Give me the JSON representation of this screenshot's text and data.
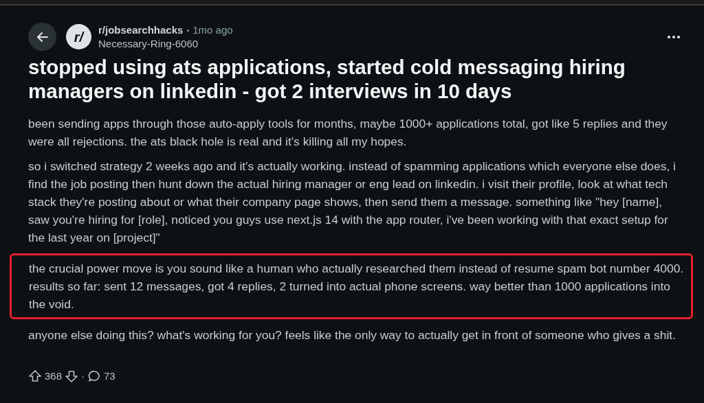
{
  "post": {
    "subreddit": "r/jobsearchhacks",
    "subreddit_icon": "r/",
    "separator": "•",
    "time": "1mo ago",
    "author": "Necessary-Ring-6060",
    "title": "stopped using ats applications, started cold messaging hiring managers on linkedin - got 2 interviews in 10 days",
    "paragraphs": [
      {
        "text": "been sending apps through those auto-apply tools for months, maybe 1000+ applications total, got like 5 replies and they were all rejections. the ats black hole is real and it's killing all my hopes.",
        "highlighted": false
      },
      {
        "text": "so i switched strategy 2 weeks ago and it's actually working. instead of spamming applications which everyone else does, i find the job posting then hunt down the actual hiring manager or eng lead on linkedin. i visit their profile, look at what tech stack they're posting about or what their company page shows, then send them a message. something like \"hey [name], saw you're hiring for [role], noticed you guys use next.js 14 with the app router, i've been working with that exact setup for the last year on [project]\"",
        "highlighted": false
      },
      {
        "text": "the crucial power move is you sound like a human who actually researched them instead of resume spam bot number 4000. results so far: sent 12 messages, got 4 replies, 2 turned into actual phone screens. way better than 1000 applications into the void.",
        "highlighted": true
      },
      {
        "text": "anyone else doing this? what's working for you? feels like the only way to actually get in front of someone who gives a shit.",
        "highlighted": false
      }
    ],
    "votes": "368",
    "dot": "·",
    "comments": "73"
  }
}
